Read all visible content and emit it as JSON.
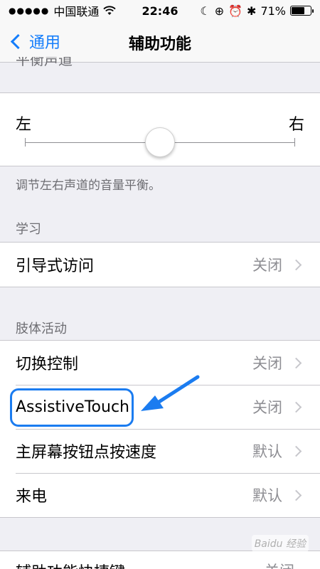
{
  "status_bar": {
    "signal": "●●●●●",
    "carrier": "中国联通",
    "wifi_icon": "wifi-icon",
    "time": "22:46",
    "icons": [
      "moon-icon",
      "rotation-lock-icon",
      "alarm-icon",
      "bluetooth-icon"
    ],
    "battery_text": "71%",
    "battery_level": 0.71
  },
  "nav": {
    "back_label": "通用",
    "title": "辅助功能"
  },
  "partial_top_text": "平衡声道",
  "balance": {
    "left_label": "左",
    "right_label": "右",
    "value": 0.5
  },
  "balance_footer": "调节左右声道的音量平衡。",
  "sections": [
    {
      "header": "学习",
      "rows": [
        {
          "label": "引导式访问",
          "value": "关闭"
        }
      ]
    },
    {
      "header": "肢体活动",
      "rows": [
        {
          "label": "切换控制",
          "value": "关闭"
        },
        {
          "label": "AssistiveTouch",
          "value": "关闭"
        },
        {
          "label": "主屏幕按钮点按速度",
          "value": "默认"
        },
        {
          "label": "来电",
          "value": "默认"
        }
      ]
    }
  ],
  "bottom_row": {
    "label": "辅助功能快捷键",
    "value": "关闭"
  },
  "watermark": "Baidu 经验",
  "colors": {
    "accent": "#157efb",
    "highlight": "#1b7cf0"
  }
}
